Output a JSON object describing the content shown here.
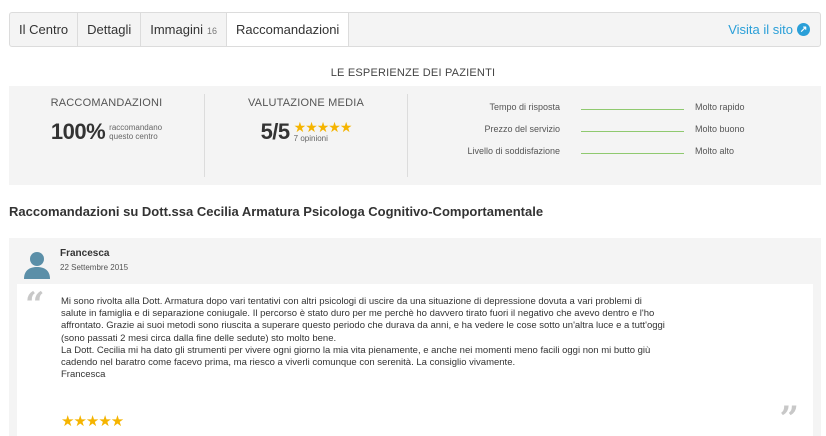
{
  "tabs": [
    {
      "label": "Il Centro",
      "count": ""
    },
    {
      "label": "Dettagli",
      "count": ""
    },
    {
      "label": "Immagini",
      "count": "16"
    },
    {
      "label": "Raccomandazioni",
      "count": ""
    }
  ],
  "visit_link": "Visita il sito",
  "section_title": "LE ESPERIENZE DEI PAZIENTI",
  "stats": {
    "recommendations": {
      "heading": "RACCOMANDAZIONI",
      "value": "100%",
      "note_line1": "raccomandano",
      "note_line2": "questo centro"
    },
    "rating": {
      "heading": "VALUTAZIONE MEDIA",
      "value": "5/5",
      "stars": "★★★★★",
      "stars_value": 5,
      "opinions": "7 opinioni"
    },
    "metrics": [
      {
        "label": "Tempo di risposta",
        "value": "Molto rapido"
      },
      {
        "label": "Prezzo del servizio",
        "value": "Molto buono"
      },
      {
        "label": "Livello di soddisfazione",
        "value": "Molto alto"
      }
    ]
  },
  "recommendations_heading": "Raccomandazioni su Dott.ssa Cecilia Armatura Psicologa Cognitivo-Comportamentale",
  "review": {
    "author": "Francesca",
    "date": "22 Settembre 2015",
    "lines": [
      "Mi sono rivolta alla Dott. Armatura dopo vari tentativi con altri psicologi di uscire da una situazione di depressione dovuta a vari problemi di",
      "salute in famiglia e di separazione coniugale. Il percorso è stato duro per me perchè ho davvero tirato fuori il negativo che avevo dentro e l'ho",
      "affrontato. Grazie ai suoi metodi sono riuscita a superare questo periodo che durava da anni, e ha vedere le cose sotto un'altra luce e a tutt'oggi",
      "(sono passati 2 mesi circa dalla fine delle sedute) sto molto bene.",
      "La Dott. Cecilia mi ha dato gli strumenti per vivere ogni giorno la mia vita pienamente, e anche nei momenti meno facili oggi non mi butto giù",
      "cadendo nel baratro come facevo prima, ma riesco a viverli comunque con serenità. La consiglio vivamente.",
      "Francesca"
    ],
    "stars": "★★★★★",
    "stars_value": 5,
    "quote_open": "“",
    "quote_close": "”"
  },
  "colors": {
    "accent": "#2a9fd8",
    "star": "#f5b400",
    "metric_line": "#8fc96f",
    "avatar": "#5b8fa8"
  },
  "icons": {
    "external_link": "external-link-icon",
    "avatar": "user-avatar-icon"
  }
}
